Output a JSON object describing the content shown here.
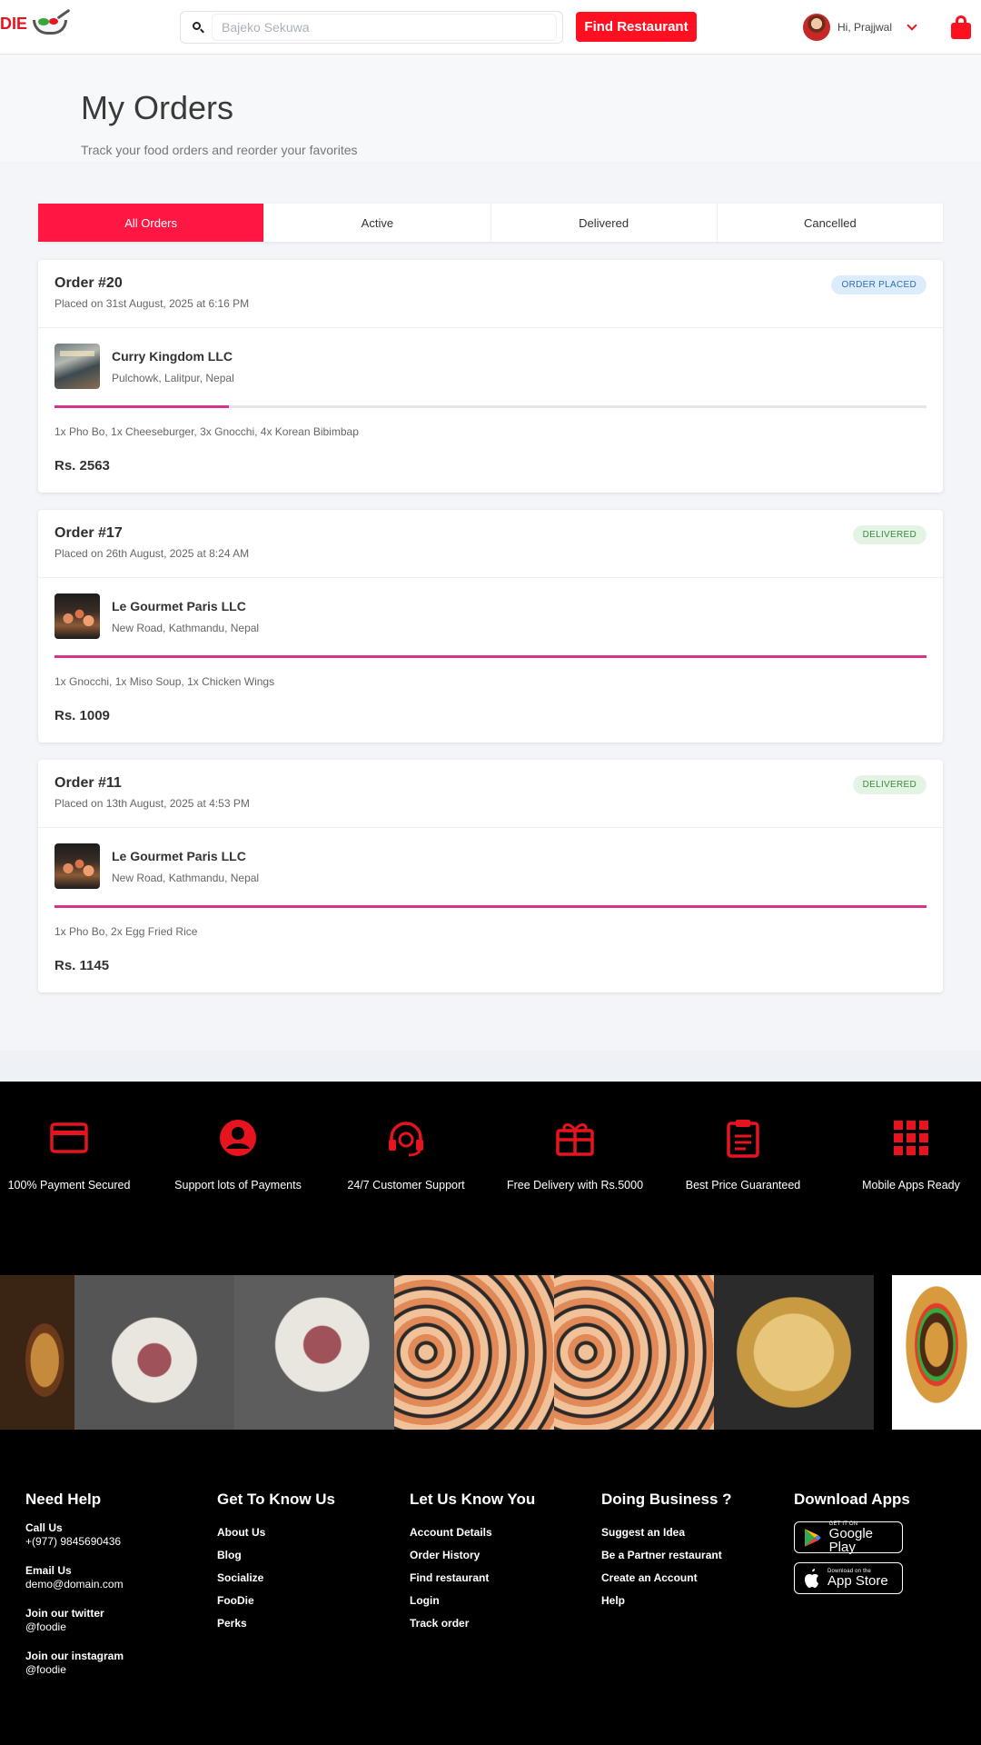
{
  "header": {
    "logo_text": "DIE",
    "search_placeholder": "Bajeko Sekuwa",
    "find_button": "Find Restaurant",
    "greeting": "Hi, Prajjwal"
  },
  "page": {
    "title": "My Orders",
    "subtitle": "Track your food orders and reorder your favorites"
  },
  "tabs": [
    {
      "label": "All Orders",
      "active": true
    },
    {
      "label": "Active",
      "active": false
    },
    {
      "label": "Delivered",
      "active": false
    },
    {
      "label": "Cancelled",
      "active": false
    }
  ],
  "orders": [
    {
      "id": "Order #20",
      "placed": "Placed on 31st August, 2025 at 6:16 PM",
      "status": "ORDER PLACED",
      "restaurant": "Curry Kingdom LLC",
      "address": "Pulchowk, Lalitpur, Nepal",
      "progress": 0.2,
      "items": "1x Pho Bo, 1x Cheeseburger, 3x Gnocchi, 4x Korean Bibimbap",
      "price": "Rs. 2563"
    },
    {
      "id": "Order #17",
      "placed": "Placed on 26th August, 2025 at 8:24 AM",
      "status": "DELIVERED",
      "restaurant": "Le Gourmet Paris LLC",
      "address": "New Road, Kathmandu, Nepal",
      "progress": 1.0,
      "items": "1x Gnocchi, 1x Miso Soup, 1x Chicken Wings",
      "price": "Rs. 1009"
    },
    {
      "id": "Order #11",
      "placed": "Placed on 13th August, 2025 at 4:53 PM",
      "status": "DELIVERED",
      "restaurant": "Le Gourmet Paris LLC",
      "address": "New Road, Kathmandu, Nepal",
      "progress": 1.0,
      "items": "1x Pho Bo, 2x Egg Fried Rice",
      "price": "Rs. 1145"
    }
  ],
  "features": [
    {
      "label": "100% Payment Secured",
      "icon": "credit-card-icon"
    },
    {
      "label": "Support lots of Payments",
      "icon": "user-circle-icon"
    },
    {
      "label": "24/7 Customer Support",
      "icon": "headset-icon"
    },
    {
      "label": "Free Delivery with Rs.5000",
      "icon": "gift-icon"
    },
    {
      "label": "Best Price Guaranteed",
      "icon": "clipboard-icon"
    },
    {
      "label": "Mobile Apps Ready",
      "icon": "grid-icon"
    }
  ],
  "footer": {
    "need_help": {
      "title": "Need Help",
      "call_label": "Call Us",
      "call_value": "+(977) 9845690436",
      "email_label": "Email Us",
      "email_value": "demo@domain.com",
      "twitter_label": "Join our twitter",
      "twitter_value": "@foodie",
      "instagram_label": "Join our instagram",
      "instagram_value": "@foodie"
    },
    "get_to_know": {
      "title": "Get To Know Us",
      "links": [
        "About Us",
        "Blog",
        "Socialize",
        "FooDie",
        "Perks"
      ]
    },
    "let_us_know": {
      "title": "Let Us Know You",
      "links": [
        "Account Details",
        "Order History",
        "Find restaurant",
        "Login",
        "Track order"
      ]
    },
    "doing_business": {
      "title": "Doing Business ?",
      "links": [
        "Suggest an Idea",
        "Be a Partner restaurant",
        "Create an Account",
        "Help"
      ]
    },
    "download": {
      "title": "Download Apps",
      "google_small": "GET IT ON",
      "google_big": "Google Play",
      "apple_small": "Download on the",
      "apple_big": "App Store"
    }
  },
  "colors": {
    "accent": "#ff1021",
    "tab_active": "#ff1744",
    "progress": "#d6338a"
  }
}
